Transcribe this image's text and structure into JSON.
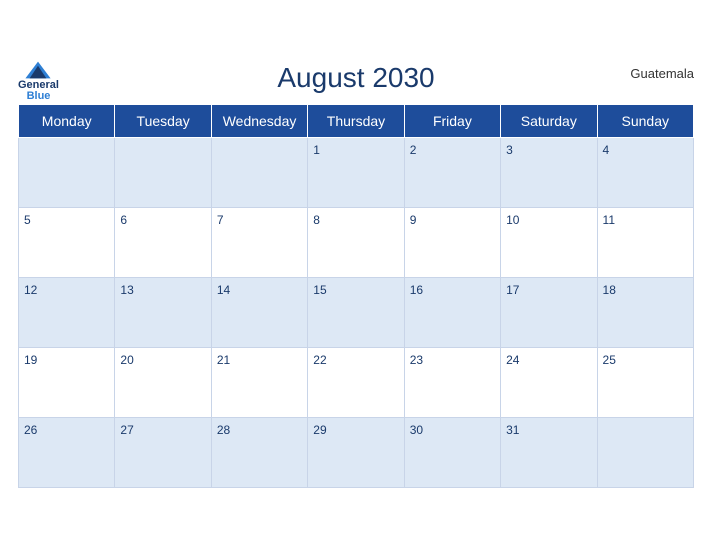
{
  "header": {
    "title": "August 2030",
    "country": "Guatemala",
    "logo": {
      "line1": "General",
      "line2": "Blue"
    }
  },
  "weekdays": [
    "Monday",
    "Tuesday",
    "Wednesday",
    "Thursday",
    "Friday",
    "Saturday",
    "Sunday"
  ],
  "weeks": [
    [
      null,
      null,
      null,
      1,
      2,
      3,
      4
    ],
    [
      5,
      6,
      7,
      8,
      9,
      10,
      11
    ],
    [
      12,
      13,
      14,
      15,
      16,
      17,
      18
    ],
    [
      19,
      20,
      21,
      22,
      23,
      24,
      25
    ],
    [
      26,
      27,
      28,
      29,
      30,
      31,
      null
    ]
  ]
}
